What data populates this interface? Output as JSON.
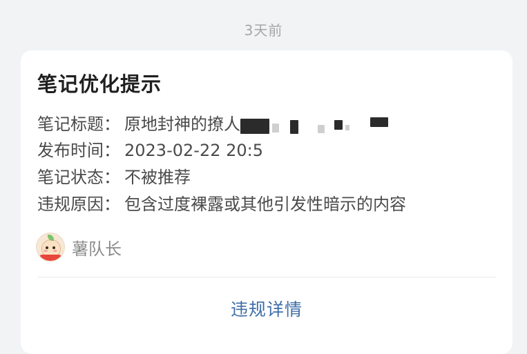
{
  "timestamp": "3天前",
  "card": {
    "title": "笔记优化提示",
    "rows": [
      {
        "label": "笔记标题：",
        "value": "原地封神的撩人"
      },
      {
        "label": "发布时间：",
        "value": "2023-02-22 20:5"
      },
      {
        "label": "笔记状态：",
        "value": "不被推荐"
      },
      {
        "label": "违规原因：",
        "value": "包含过度裸露或其他引发性暗示的内容"
      }
    ],
    "sender": {
      "name": "薯队长",
      "avatar": "potato-mascot-avatar"
    },
    "action_label": "违规详情"
  },
  "colors": {
    "background": "#f2f3f5",
    "card": "#ffffff",
    "link": "#3f6ea8",
    "muted": "#a6a6a6"
  }
}
